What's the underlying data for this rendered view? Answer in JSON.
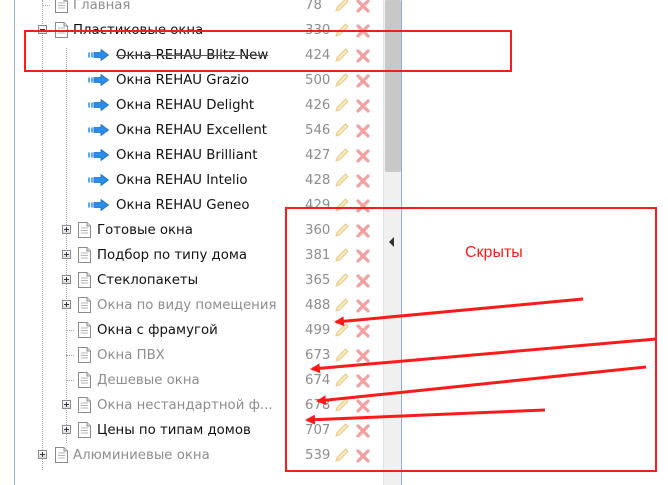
{
  "tree": {
    "rows": [
      {
        "label": "Главная",
        "count": "78",
        "kind": "page",
        "hidden": true,
        "depth": 1,
        "expander": "none"
      },
      {
        "label": "Пластиковые окна",
        "count": "330",
        "kind": "page",
        "hidden": false,
        "depth": 1,
        "expander": "minus"
      },
      {
        "label": "Окна REHAU Blitz New",
        "count": "424",
        "kind": "link",
        "hidden": false,
        "depth": 2,
        "expander": "none"
      },
      {
        "label": "Окна REHAU Grazio",
        "count": "500",
        "kind": "link",
        "hidden": false,
        "depth": 2,
        "expander": "none"
      },
      {
        "label": "Окна REHAU Delight",
        "count": "426",
        "kind": "link",
        "hidden": false,
        "depth": 2,
        "expander": "none"
      },
      {
        "label": "Окна REHAU Excellent",
        "count": "546",
        "kind": "link",
        "hidden": false,
        "depth": 2,
        "expander": "none"
      },
      {
        "label": "Окна REHAU Brilliant",
        "count": "427",
        "kind": "link",
        "hidden": false,
        "depth": 2,
        "expander": "none"
      },
      {
        "label": "Окна REHAU Intelio",
        "count": "428",
        "kind": "link",
        "hidden": false,
        "depth": 2,
        "expander": "none"
      },
      {
        "label": "Окна REHAU Geneo",
        "count": "429",
        "kind": "link",
        "hidden": false,
        "depth": 2,
        "expander": "none"
      },
      {
        "label": "Готовые окна",
        "count": "360",
        "kind": "page",
        "hidden": false,
        "depth": 2,
        "expander": "plus"
      },
      {
        "label": "Подбор по типу дома",
        "count": "381",
        "kind": "page",
        "hidden": false,
        "depth": 2,
        "expander": "plus"
      },
      {
        "label": "Стеклопакеты",
        "count": "365",
        "kind": "page",
        "hidden": false,
        "depth": 2,
        "expander": "plus"
      },
      {
        "label": "Окна по виду помещения",
        "count": "488",
        "kind": "page",
        "hidden": true,
        "depth": 2,
        "expander": "plus"
      },
      {
        "label": "Окна с фрамугой",
        "count": "499",
        "kind": "page",
        "hidden": false,
        "depth": 2,
        "expander": "none"
      },
      {
        "label": "Окна ПВХ",
        "count": "673",
        "kind": "page",
        "hidden": true,
        "depth": 2,
        "expander": "none"
      },
      {
        "label": "Дешевые окна",
        "count": "674",
        "kind": "page",
        "hidden": true,
        "depth": 2,
        "expander": "none"
      },
      {
        "label": "Окна нестандартной ф...",
        "count": "678",
        "kind": "page",
        "hidden": true,
        "depth": 2,
        "expander": "plus"
      },
      {
        "label": "Цены по типам домов",
        "count": "707",
        "kind": "page",
        "hidden": false,
        "depth": 2,
        "expander": "plus"
      },
      {
        "label": "Алюминиевые окна",
        "count": "539",
        "kind": "page",
        "hidden": true,
        "depth": 1,
        "expander": "plus"
      }
    ]
  },
  "annotation": {
    "callout_text": "Скрыты",
    "color": "#ff1a1a"
  },
  "icons": {
    "page": "document-icon",
    "link": "link-arrow-icon",
    "edit": "pencil-icon",
    "delete": "delete-x-icon"
  },
  "colors": {
    "frame_border": "#8fb1d9",
    "hidden_text": "#8d8d8d",
    "normal_text": "#111111",
    "link_arrow": "#2a8ee8"
  }
}
